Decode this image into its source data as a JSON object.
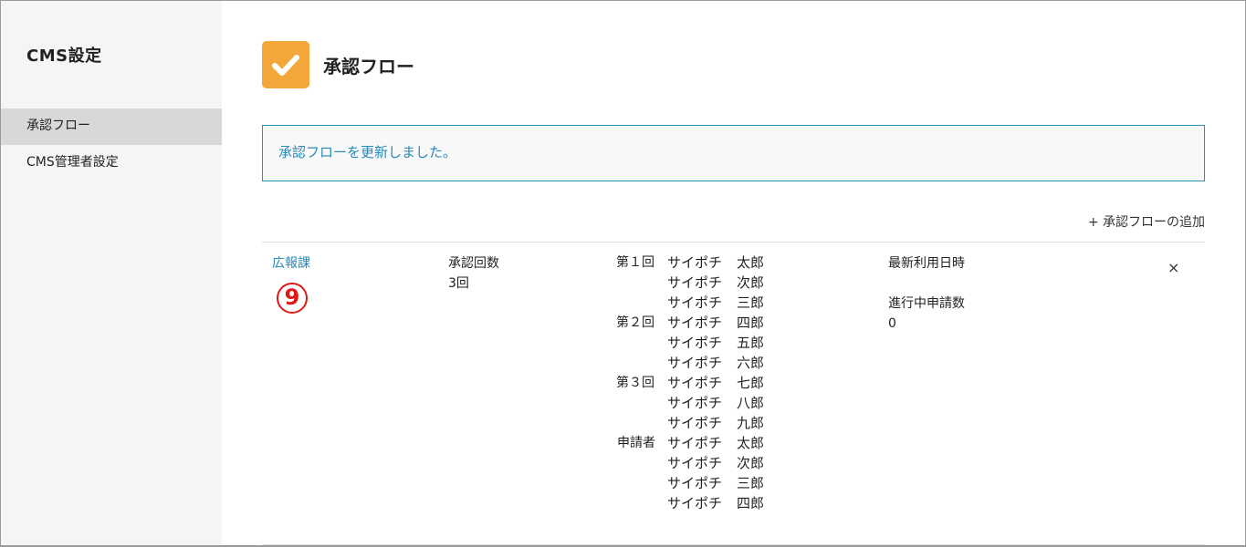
{
  "sidebar": {
    "title": "CMS設定",
    "items": [
      {
        "label": "承認フロー",
        "active": true
      },
      {
        "label": "CMS管理者設定",
        "active": false
      }
    ]
  },
  "header": {
    "icon": "check-icon",
    "title": "承認フロー",
    "icon_color": "#f3a63a"
  },
  "notice": {
    "message": "承認フローを更新しました。"
  },
  "actions": {
    "add_flow": "+ 承認フローの追加"
  },
  "flow": {
    "name": "広報課",
    "annotation": "9",
    "count_label": "承認回数",
    "count_value": "3回",
    "steps": [
      {
        "label": "第１回",
        "approvers": [
          {
            "family": "サイポチ",
            "given": "太郎"
          },
          {
            "family": "サイポチ",
            "given": "次郎"
          },
          {
            "family": "サイポチ",
            "given": "三郎"
          }
        ]
      },
      {
        "label": "第２回",
        "approvers": [
          {
            "family": "サイポチ",
            "given": "四郎"
          },
          {
            "family": "サイポチ",
            "given": "五郎"
          },
          {
            "family": "サイポチ",
            "given": "六郎"
          }
        ]
      },
      {
        "label": "第３回",
        "approvers": [
          {
            "family": "サイポチ",
            "given": "七郎"
          },
          {
            "family": "サイポチ",
            "given": "八郎"
          },
          {
            "family": "サイポチ",
            "given": "九郎"
          }
        ]
      },
      {
        "label": "申請者",
        "approvers": [
          {
            "family": "サイポチ",
            "given": "太郎"
          },
          {
            "family": "サイポチ",
            "given": "次郎"
          },
          {
            "family": "サイポチ",
            "given": "三郎"
          },
          {
            "family": "サイポチ",
            "given": "四郎"
          }
        ]
      }
    ],
    "last_used_label": "最新利用日時",
    "last_used_value": "",
    "in_progress_label": "進行中申請数",
    "in_progress_value": "0",
    "delete_label": "×"
  },
  "colors": {
    "accent": "#f3a63a",
    "link": "#2a8ab8",
    "annotation": "#e01818"
  }
}
